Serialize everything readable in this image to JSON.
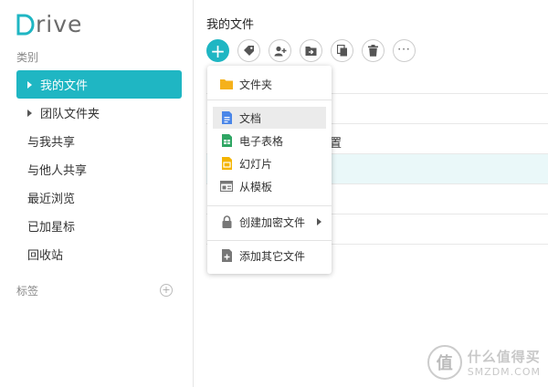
{
  "app": {
    "logo_text": "rive"
  },
  "sidebar": {
    "category_label": "类别",
    "items": [
      {
        "label": "我的文件"
      },
      {
        "label": "团队文件夹"
      },
      {
        "label": "与我共享"
      },
      {
        "label": "与他人共享"
      },
      {
        "label": "最近浏览"
      },
      {
        "label": "已加星标"
      },
      {
        "label": "回收站"
      }
    ],
    "tags_label": "标签",
    "tags_add_symbol": "+"
  },
  "main": {
    "title": "我的文件",
    "toolbar": {
      "new_symbol": "+",
      "more_symbol": "···"
    },
    "peek_text": "置"
  },
  "new_menu": {
    "items": [
      {
        "label": "文件夹",
        "icon": "folder-icon"
      },
      {
        "label": "文档",
        "icon": "document-icon"
      },
      {
        "label": "电子表格",
        "icon": "spreadsheet-icon"
      },
      {
        "label": "幻灯片",
        "icon": "slides-icon"
      },
      {
        "label": "从模板",
        "icon": "template-icon"
      },
      {
        "label": "创建加密文件",
        "icon": "lock-icon"
      },
      {
        "label": "添加其它文件",
        "icon": "add-file-icon"
      }
    ]
  },
  "watermark": {
    "symbol": "值",
    "cn": "什么值得买",
    "en": "SMZDM.COM"
  },
  "colors": {
    "accent": "#1fb6c3",
    "folder": "#f5b11b",
    "doc": "#4a86e8",
    "sheet": "#2fa664",
    "slides": "#f4b400"
  }
}
